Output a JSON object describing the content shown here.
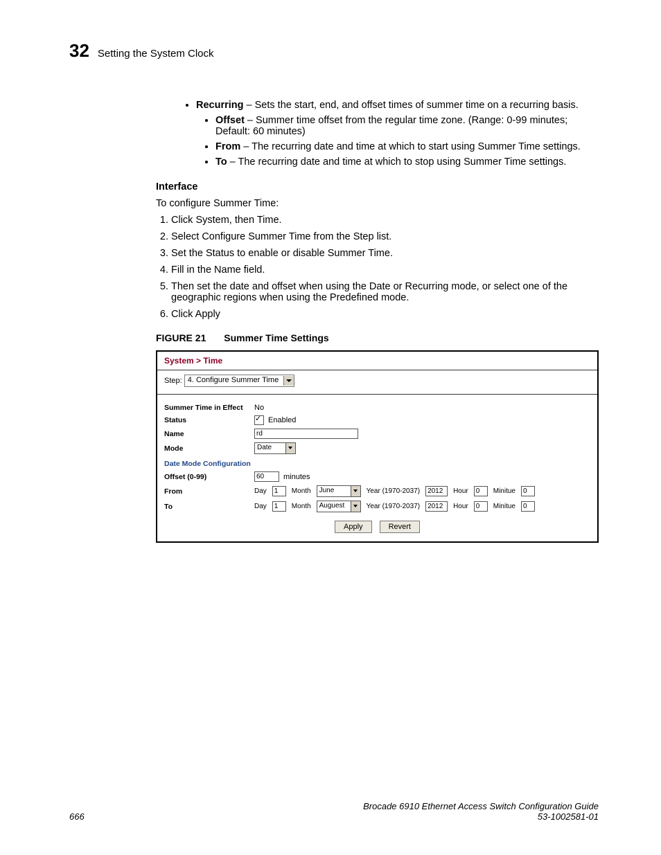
{
  "header": {
    "chapter_number": "32",
    "chapter_title": "Setting the System Clock"
  },
  "bullets": {
    "recurring_term": "Recurring",
    "recurring_text": " – Sets the start, end, and offset times of summer time on a recurring basis.",
    "offset_term": "Offset",
    "offset_text": " – Summer time offset from the regular time zone. (Range: 0-99 minutes; Default: 60 minutes)",
    "from_term": "From",
    "from_text": " – The recurring date and time at which to start using Summer Time settings.",
    "to_term": "To",
    "to_text": " – The recurring date and time at which to stop using Summer Time settings."
  },
  "interface": {
    "heading": "Interface",
    "intro": "To configure Summer Time:",
    "steps": [
      "Click System, then Time.",
      "Select Configure Summer Time from the Step list.",
      "Set the Status to enable or disable Summer Time.",
      "Fill in the Name field.",
      "Then set the date and offset when using the Date or Recurring mode, or select one of the geographic regions when using the Predefined mode.",
      "Click Apply"
    ]
  },
  "figure": {
    "label": "FIGURE 21",
    "title": "Summer Time Settings"
  },
  "shot": {
    "breadcrumb": "System > Time",
    "step_label": "Step:",
    "step_value": "4. Configure Summer Time",
    "rows": {
      "summer_in_effect_label": "Summer Time in Effect",
      "summer_in_effect_value": "No",
      "status_label": "Status",
      "status_value": "Enabled",
      "name_label": "Name",
      "name_value": "rd",
      "mode_label": "Mode",
      "mode_value": "Date"
    },
    "subheading": "Date Mode Configuration",
    "offset_label": "Offset (0-99)",
    "offset_value": "60",
    "offset_unit": "minutes",
    "from_label": "From",
    "to_label": "To",
    "fields": {
      "day": "Day",
      "month": "Month",
      "year": "Year (1970-2037)",
      "hour": "Hour",
      "minute": "Minitue"
    },
    "from": {
      "day": "1",
      "month": "June",
      "year": "2012",
      "hour": "0",
      "minute": "0"
    },
    "to": {
      "day": "1",
      "month": "Auguest",
      "year": "2012",
      "hour": "0",
      "minute": "0"
    },
    "apply": "Apply",
    "revert": "Revert"
  },
  "footer": {
    "page": "666",
    "title": "Brocade 6910 Ethernet Access Switch Configuration Guide",
    "docnum": "53-1002581-01"
  }
}
